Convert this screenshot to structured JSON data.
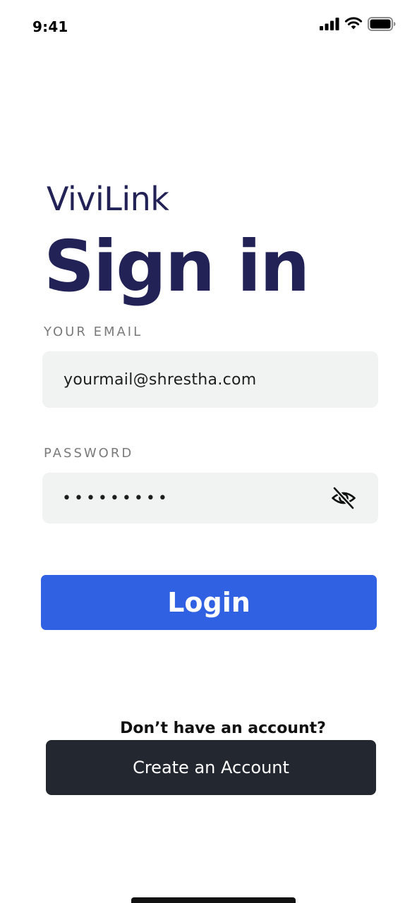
{
  "status_bar": {
    "time": "9:41",
    "icons": [
      "cellular-signal-icon",
      "wifi-icon",
      "battery-icon"
    ]
  },
  "brand": {
    "name": "ViviLink"
  },
  "page": {
    "title": "Sign in"
  },
  "form": {
    "email": {
      "label": "YOUR EMAIL",
      "value": "yourmail@shrestha.com"
    },
    "password": {
      "label": "PASSWORD",
      "value": "•••••••••",
      "toggle_icon": "eye-slash-icon"
    },
    "login_label": "Login"
  },
  "signup": {
    "prompt": "Don’t have an account?",
    "button_label": "Create an Account"
  },
  "colors": {
    "brand_text": "#222257",
    "primary": "#3061e3",
    "dark_button": "#23272f",
    "input_background": "#f1f2f2",
    "label_gray": "#7a7a7a"
  }
}
